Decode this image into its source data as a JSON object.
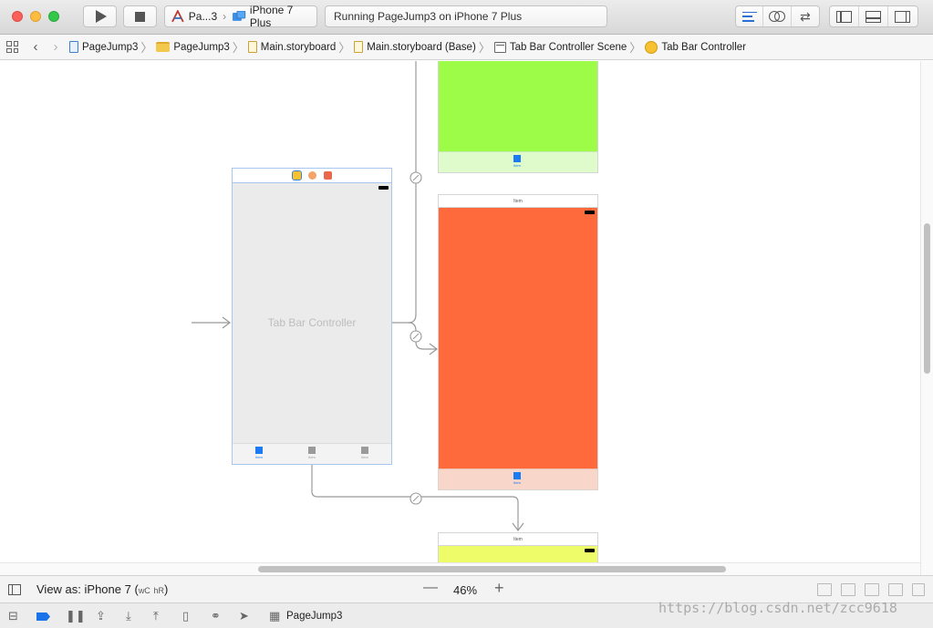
{
  "toolbar": {
    "scheme_app": "Pa...3",
    "scheme_device": "iPhone 7 Plus",
    "status_text": "Running PageJump3 on iPhone 7 Plus"
  },
  "breadcrumb": [
    {
      "label": "PageJump3",
      "icon": "project-icon"
    },
    {
      "label": "PageJump3",
      "icon": "folder-icon"
    },
    {
      "label": "Main.storyboard",
      "icon": "storyboard-icon"
    },
    {
      "label": "Main.storyboard (Base)",
      "icon": "storyboard-icon"
    },
    {
      "label": "Tab Bar Controller Scene",
      "icon": "scene-icon"
    },
    {
      "label": "Tab Bar Controller",
      "icon": "tab-bar-controller-icon"
    }
  ],
  "canvas": {
    "tab_bar_controller_label": "Tab Bar Controller",
    "tab_item_label": "Item",
    "scene_header_label": "Item",
    "colors": {
      "green_scene": "#9dfc48",
      "orange_scene": "#ff6a3d",
      "yellow_scene": "#eefc6a",
      "selection_blue": "#a9c6ee",
      "tab_selected": "#1a7bf2"
    }
  },
  "interface_builder_bar": {
    "view_as_label": "View as: iPhone 7",
    "size_class_w": "wC",
    "size_class_h": "hR",
    "zoom_minus": "—",
    "zoom_level": "46%",
    "zoom_plus": "+"
  },
  "debug_bar": {
    "target_label": "PageJump3"
  },
  "watermark": "https://blog.csdn.net/zcc9618"
}
